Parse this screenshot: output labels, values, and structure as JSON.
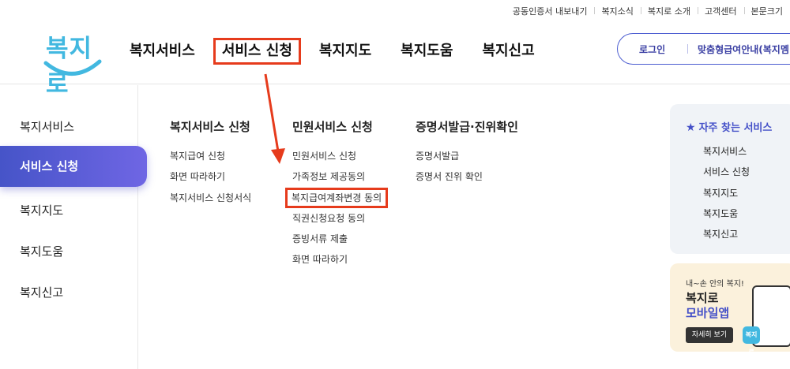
{
  "util_links": [
    "공동인증서 내보내기",
    "복지소식",
    "복지로 소개",
    "고객센터",
    "본문크기"
  ],
  "logo": "복지로",
  "gnb": [
    "복지서비스",
    "서비스 신청",
    "복지지도",
    "복지도움",
    "복지신고"
  ],
  "login": {
    "login_label": "로그인",
    "guide_label": "맞춤형급여안내(복지멤"
  },
  "leftnav": [
    "복지서비스",
    "서비스 신청",
    "복지지도",
    "복지도움",
    "복지신고"
  ],
  "columns": [
    {
      "title": "복지서비스 신청",
      "links": [
        "복지급여 신청",
        "화면 따라하기",
        "복지서비스 신청서식"
      ]
    },
    {
      "title": "민원서비스 신청",
      "links": [
        "민원서비스 신청",
        "가족정보 제공동의",
        "복지급여계좌변경 동의",
        "직권신청요청 동의",
        "증빙서류 제출",
        "화면 따라하기"
      ]
    },
    {
      "title": "증명서발급·진위확인",
      "links": [
        "증명서발급",
        "증명서 진위 확인"
      ]
    }
  ],
  "favorites": {
    "title": "자주 찾는 서비스",
    "items": [
      "복지서비스",
      "서비스 신청",
      "복지지도",
      "복지도움",
      "복지신고"
    ]
  },
  "app_banner": {
    "small": "내~손 안의 복지!",
    "line1": "복지로",
    "line2": "모바일앱",
    "button": "자세히 보기",
    "icon_label": "복지로"
  },
  "colors": {
    "accent": "#4450c8",
    "highlight": "#e63b1c",
    "logo": "#42b8e0"
  }
}
